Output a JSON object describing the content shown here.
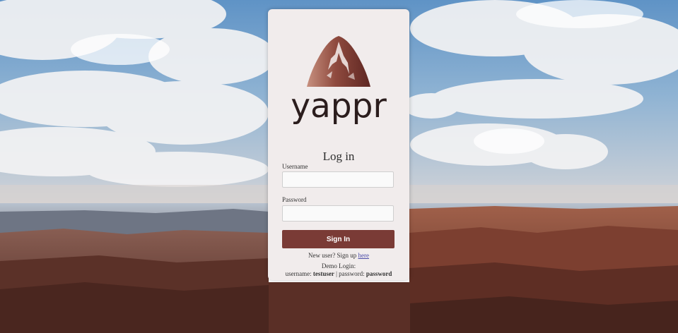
{
  "brand": {
    "name": "yappr",
    "logo_icon": "mountain-logo-icon",
    "colors": {
      "primary": "#7a3b36",
      "logo_light": "#c7907f",
      "logo_dark": "#6d2e2a",
      "text_dark": "#2b1d1d"
    }
  },
  "login": {
    "title": "Log in",
    "username_label": "Username",
    "username_value": "",
    "password_label": "Password",
    "password_value": "",
    "submit_label": "Sign In",
    "signup_prefix": "New user? Sign up",
    "signup_link": "here",
    "demo_heading": "Demo Login:",
    "demo_user_label": "username:",
    "demo_user_value": "testuser",
    "demo_separator": "|",
    "demo_pass_label": "password:",
    "demo_pass_value": "password"
  },
  "background": {
    "scene": "canyon-landscape-photo"
  }
}
